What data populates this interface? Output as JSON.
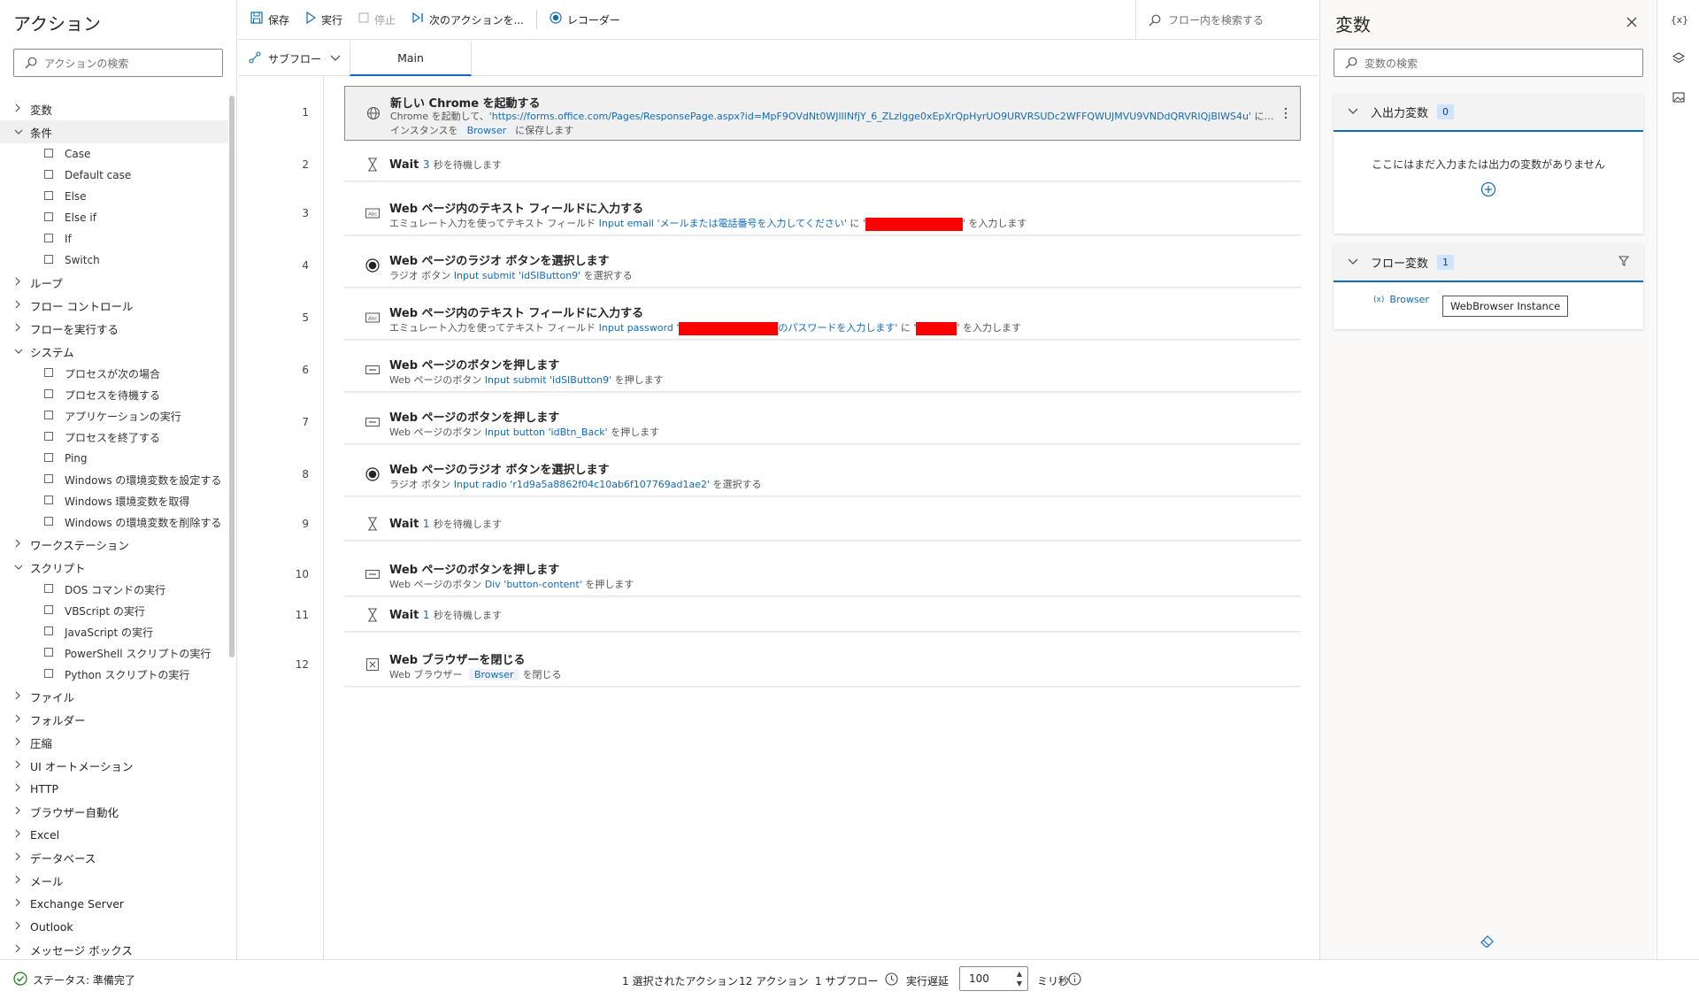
{
  "left": {
    "title": "アクション",
    "search_placeholder": "アクションの検索",
    "tree": [
      {
        "label": "変数",
        "open": false
      },
      {
        "label": "条件",
        "open": true,
        "children": [
          {
            "icon": "case-icon",
            "label": "Case"
          },
          {
            "icon": "default-case-icon",
            "label": "Default case"
          },
          {
            "icon": "else-icon",
            "label": "Else"
          },
          {
            "icon": "else-if-icon",
            "label": "Else if"
          },
          {
            "icon": "if-icon",
            "label": "If"
          },
          {
            "icon": "switch-icon",
            "label": "Switch"
          }
        ]
      },
      {
        "label": "ループ",
        "open": false
      },
      {
        "label": "フロー コントロール",
        "open": false
      },
      {
        "label": "フローを実行する",
        "open": false
      },
      {
        "label": "システム",
        "open": true,
        "children": [
          {
            "icon": "process-condition-icon",
            "label": "プロセスが次の場合"
          },
          {
            "icon": "hourglass-icon",
            "label": "プロセスを待機する"
          },
          {
            "icon": "play-icon",
            "label": "アプリケーションの実行"
          },
          {
            "icon": "terminate-icon",
            "label": "プロセスを終了する"
          },
          {
            "icon": "ping-icon",
            "label": "Ping"
          },
          {
            "icon": "variable-icon",
            "label": "Windows の環境変数を設定する"
          },
          {
            "icon": "variable-icon",
            "label": "Windows 環境変数を取得"
          },
          {
            "icon": "variable-icon",
            "label": "Windows の環境変数を削除する"
          }
        ]
      },
      {
        "label": "ワークステーション",
        "open": false
      },
      {
        "label": "スクリプト",
        "open": true,
        "children": [
          {
            "icon": "dos-icon",
            "label": "DOS コマンドの実行"
          },
          {
            "icon": "vbscript-icon",
            "label": "VBScript の実行"
          },
          {
            "icon": "javascript-icon",
            "label": "JavaScript の実行"
          },
          {
            "icon": "powershell-icon",
            "label": "PowerShell スクリプトの実行"
          },
          {
            "icon": "python-icon",
            "label": "Python スクリプトの実行"
          }
        ]
      },
      {
        "label": "ファイル",
        "open": false
      },
      {
        "label": "フォルダー",
        "open": false
      },
      {
        "label": "圧縮",
        "open": false
      },
      {
        "label": "UI オートメーション",
        "open": false
      },
      {
        "label": "HTTP",
        "open": false
      },
      {
        "label": "ブラウザー自動化",
        "open": false
      },
      {
        "label": "Excel",
        "open": false
      },
      {
        "label": "データベース",
        "open": false
      },
      {
        "label": "メール",
        "open": false
      },
      {
        "label": "Exchange Server",
        "open": false
      },
      {
        "label": "Outlook",
        "open": false
      },
      {
        "label": "メッセージ ボックス",
        "open": false
      }
    ]
  },
  "toolbar": {
    "save": "保存",
    "run": "実行",
    "stop": "停止",
    "next_action": "次のアクションを...",
    "recorder": "レコーダー",
    "flow_search_placeholder": "フロー内を検索する"
  },
  "tabs": {
    "subflow": "サブフロー",
    "main": "Main"
  },
  "steps": [
    {
      "num": "1",
      "icon": "globe-icon",
      "title": "新しい Chrome を起動する",
      "desc_a": "Chrome を起動して、",
      "desc_link": "'https://forms.office.com/Pages/ResponsePage.aspx?id=MpF9OVdNt0WJlIlNfjY_6_ZLzlgge0xEpXrQpHyrUO9URVRSUDc2WFFQWUJMVU9VNDdQRVRIQjBIWS4u'",
      "desc_b": " に移動し、",
      "desc2_a": "インスタンスを",
      "desc2_chip": "Browser",
      "desc2_b": "に保存します"
    },
    {
      "num": "2",
      "icon": "hourglass-icon",
      "title": "Wait",
      "title_val": "3",
      "title_rest": "秒を待機します"
    },
    {
      "num": "3",
      "icon": "textfield-icon",
      "title": "Web ページ内のテキスト フィールドに入力する",
      "desc_a": "エミュレート入力を使ってテキスト フィールド ",
      "desc_link": "Input email 'メールまたは電話番号を入力してください'",
      "desc_b": " に '",
      "redact1": 110,
      "desc_c": "' を入力します"
    },
    {
      "num": "4",
      "icon": "radio-icon",
      "title": "Web ページのラジオ ボタンを選択します",
      "desc_a": "ラジオ ボタン ",
      "desc_link": "Input submit 'idSIButton9'",
      "desc_b": " を選択する"
    },
    {
      "num": "5",
      "icon": "textfield-icon",
      "title": "Web ページ内のテキスト フィールドに入力する",
      "desc_a": "エミュレート入力を使ってテキスト フィールド ",
      "desc_link": "Input password '",
      "redact1": 112,
      "desc_link2": "のパスワードを入力します'",
      "desc_b": " に '",
      "redact2": 46,
      "desc_c": "' を入力します"
    },
    {
      "num": "6",
      "icon": "button-icon",
      "title": "Web ページのボタンを押します",
      "desc_a": "Web ページのボタン ",
      "desc_link": "Input submit 'idSIButton9'",
      "desc_b": " を押します"
    },
    {
      "num": "7",
      "icon": "button-icon",
      "title": "Web ページのボタンを押します",
      "desc_a": "Web ページのボタン ",
      "desc_link": "Input button 'idBtn_Back'",
      "desc_b": " を押します"
    },
    {
      "num": "8",
      "icon": "radio-icon",
      "title": "Web ページのラジオ ボタンを選択します",
      "desc_a": "ラジオ ボタン ",
      "desc_link": "Input radio 'r1d9a5a8862f04c10ab6f107769ad1ae2'",
      "desc_b": " を選択する"
    },
    {
      "num": "9",
      "icon": "hourglass-icon",
      "title": "Wait",
      "title_val": "1",
      "title_rest": "秒を待機します"
    },
    {
      "num": "10",
      "icon": "button-icon",
      "title": "Web ページのボタンを押します",
      "desc_a": "Web ページのボタン ",
      "desc_link": "Div 'button-content'",
      "desc_b": " を押します"
    },
    {
      "num": "11",
      "icon": "hourglass-icon",
      "title": "Wait",
      "title_val": "1",
      "title_rest": "秒を待機します"
    },
    {
      "num": "12",
      "icon": "close-browser-icon",
      "title": "Web ブラウザーを閉じる",
      "desc_a": "Web ブラウザー ",
      "desc_chip": "Browser",
      "desc_b": "を閉じる"
    }
  ],
  "vars": {
    "title": "変数",
    "search_placeholder": "変数の検索",
    "io_title": "入出力変数",
    "io_count": "0",
    "io_empty": "ここにはまだ入力または出力の変数がありません",
    "flow_title": "フロー変数",
    "flow_count": "1",
    "flow_var_name": "Browser",
    "flow_var_icon": "(x)",
    "tooltip": "WebBrowser Instance"
  },
  "status": {
    "state": "ステータス: 準備完了",
    "selected": "1 選択されたアクション",
    "actions": "12 アクション",
    "subflows": "1 サブフロー",
    "delay_label": "実行遅延",
    "delay_value": "100",
    "delay_unit": "ミリ秒"
  },
  "colors": {
    "accent": "#0f6cbd",
    "redaction": "#ff0000",
    "status_ok": "#107c10"
  }
}
